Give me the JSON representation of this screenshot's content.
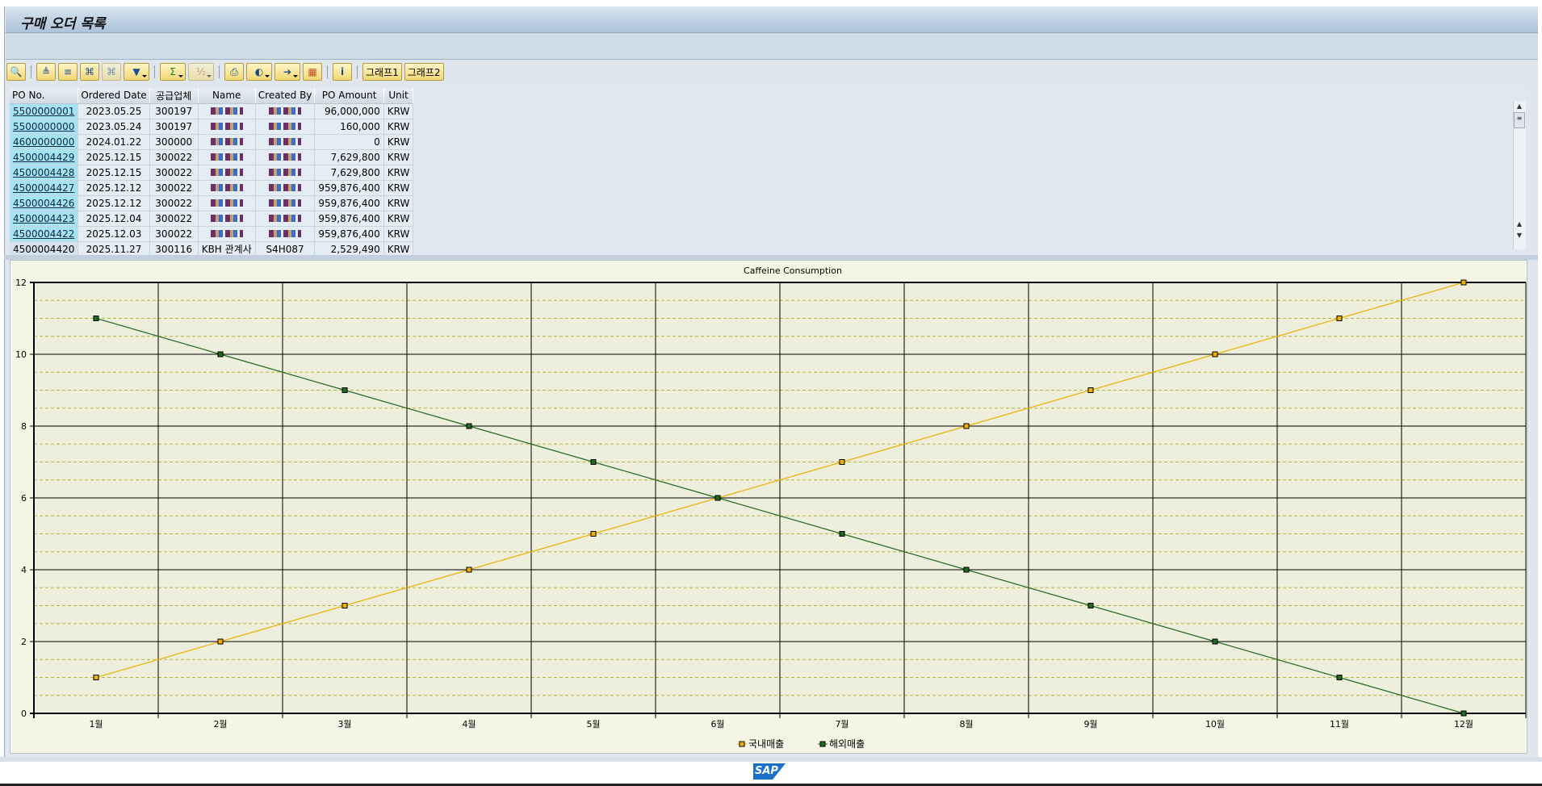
{
  "window": {
    "title": "구매 오더 목록"
  },
  "toolbar": {
    "buttons": [
      {
        "icon": "details-icon"
      },
      {
        "icon": "sort-ascending-icon"
      },
      {
        "icon": "sort-descending-icon"
      },
      {
        "icon": "find-icon"
      },
      {
        "icon": "find-next-icon"
      },
      {
        "icon": "filter-icon"
      },
      {
        "icon": "sum-icon"
      },
      {
        "icon": "subtotal-icon"
      },
      {
        "icon": "print-icon"
      },
      {
        "icon": "views-icon"
      },
      {
        "icon": "export-icon"
      },
      {
        "icon": "layout-icon"
      },
      {
        "icon": "info-icon"
      }
    ],
    "graph1": "그래프1",
    "graph2": "그래프2"
  },
  "table": {
    "columns": [
      "PO No.",
      "Ordered Date",
      "공급업체",
      "Name",
      "Created By",
      "PO Amount",
      "Unit"
    ],
    "rows": [
      [
        "5500000001",
        "2023.05.25",
        "300197",
        "",
        "",
        "96,000,000",
        "KRW"
      ],
      [
        "5500000000",
        "2023.05.24",
        "300197",
        "",
        "",
        "160,000",
        "KRW"
      ],
      [
        "4600000000",
        "2024.01.22",
        "300000",
        "",
        "",
        "0",
        "KRW"
      ],
      [
        "4500004429",
        "2025.12.15",
        "300022",
        "",
        "",
        "7,629,800",
        "KRW"
      ],
      [
        "4500004428",
        "2025.12.15",
        "300022",
        "",
        "",
        "7,629,800",
        "KRW"
      ],
      [
        "4500004427",
        "2025.12.12",
        "300022",
        "",
        "",
        "959,876,400",
        "KRW"
      ],
      [
        "4500004426",
        "2025.12.12",
        "300022",
        "",
        "",
        "959,876,400",
        "KRW"
      ],
      [
        "4500004423",
        "2025.12.04",
        "300022",
        "",
        "",
        "959,876,400",
        "KRW"
      ],
      [
        "4500004422",
        "2025.12.03",
        "300022",
        "",
        "",
        "959,876,400",
        "KRW"
      ],
      [
        "4500004420",
        "2025.11.27",
        "300116",
        "KBH 관계사",
        "S4H087",
        "2,529,490",
        "KRW"
      ]
    ]
  },
  "chart_data": {
    "type": "line",
    "title": "Caffeine Consumption",
    "categories": [
      "1월",
      "2월",
      "3월",
      "4월",
      "5월",
      "6월",
      "7월",
      "8월",
      "9월",
      "10월",
      "11월",
      "12월"
    ],
    "series": [
      {
        "name": "국내매출",
        "values": [
          1,
          2,
          3,
          4,
          5,
          6,
          7,
          8,
          9,
          10,
          11,
          12
        ],
        "color": "#f0b000"
      },
      {
        "name": "해외매출",
        "values": [
          11,
          10,
          9,
          8,
          7,
          6,
          5,
          4,
          3,
          2,
          1,
          0
        ],
        "color": "#1f6b1f"
      }
    ],
    "ylim": [
      0,
      12
    ],
    "yticks": [
      0,
      2,
      4,
      6,
      8,
      10,
      12
    ],
    "grid": true,
    "legend": "bottom"
  },
  "footer": {
    "logo": "SAP"
  }
}
